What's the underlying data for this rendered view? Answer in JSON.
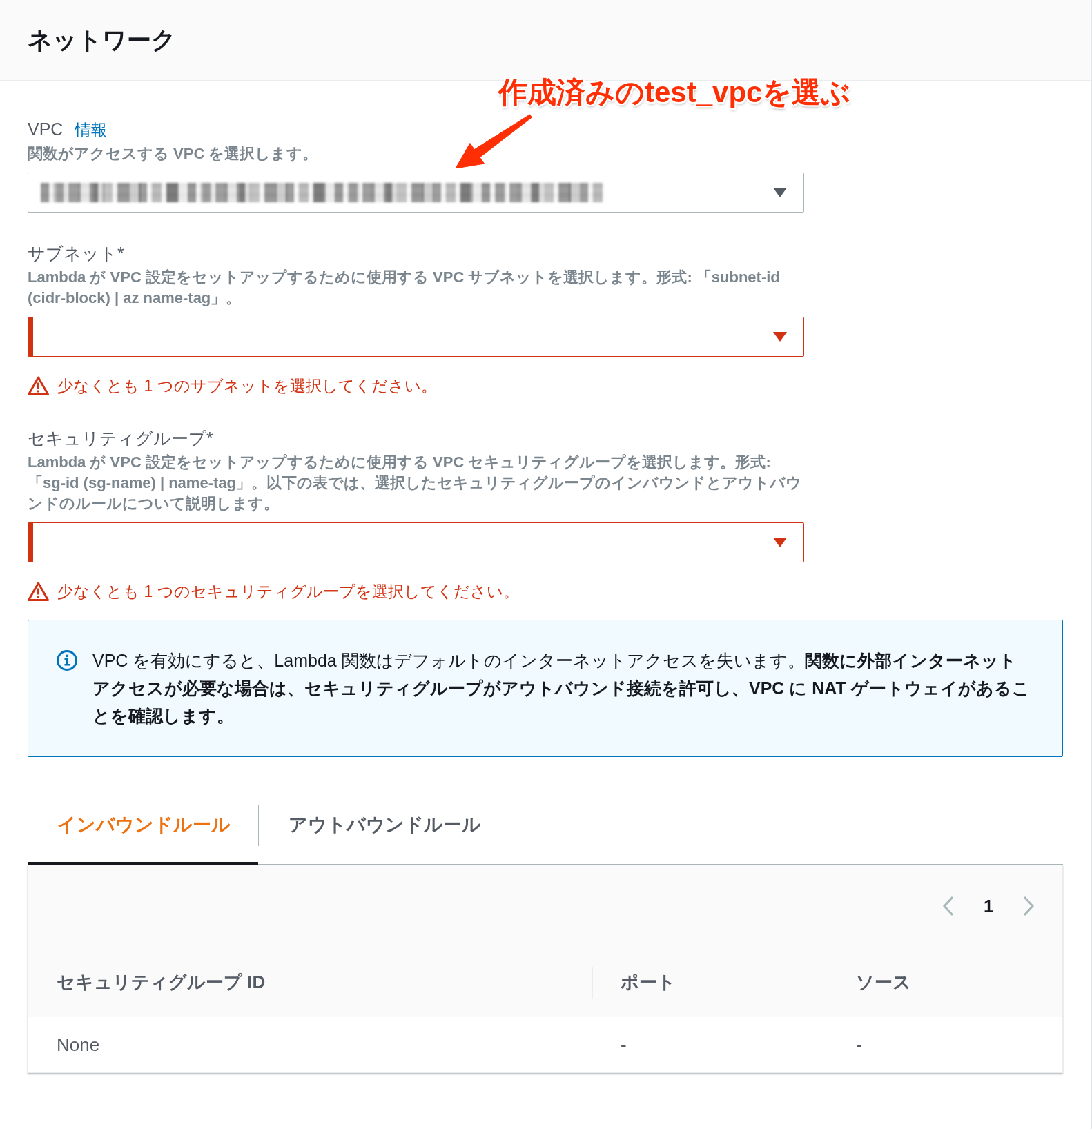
{
  "header": {
    "title": "ネットワーク"
  },
  "annotation": {
    "text": "作成済みのtest_vpcを選ぶ"
  },
  "fields": [
    {
      "label": "VPC",
      "info_link": "情報",
      "description": "関数がアクセスする VPC を選択します。",
      "value_blurred": true,
      "invalid": false
    },
    {
      "label": "サブネット*",
      "description": "Lambda が VPC 設定をセットアップするために使用する VPC サブネットを選択します。形式: 「subnet-id (cidr-block) | az name-tag」。",
      "value_blurred": false,
      "invalid": true,
      "error": "少なくとも 1 つのサブネットを選択してください。"
    },
    {
      "label": "セキュリティグループ*",
      "description": "Lambda が VPC 設定をセットアップするために使用する VPC セキュリティグループを選択します。形式: 「sg-id (sg-name) | name-tag」。以下の表では、選択したセキュリティグループのインバウンドとアウトバウンドのルールについて説明します。",
      "value_blurred": false,
      "invalid": true,
      "error": "少なくとも 1 つのセキュリティグループを選択してください。"
    }
  ],
  "info_alert": {
    "text": "VPC を有効にすると、Lambda 関数はデフォルトのインターネットアクセスを失います。**関数に外部インターネットアクセスが必要な場合は、セキュリティグループがアウトバウンド接続を許可し、VPC に NAT ゲートウェイがあることを確認します。**"
  },
  "tabs": [
    {
      "label": "インバウンドルール",
      "selected": true
    },
    {
      "label": "アウトバウンドルール",
      "selected": false
    }
  ],
  "table": {
    "page": "1",
    "columns": [
      "セキュリティグループ ID",
      "ポート",
      "ソース"
    ],
    "rows": [
      [
        "None",
        "-",
        "-"
      ]
    ]
  }
}
